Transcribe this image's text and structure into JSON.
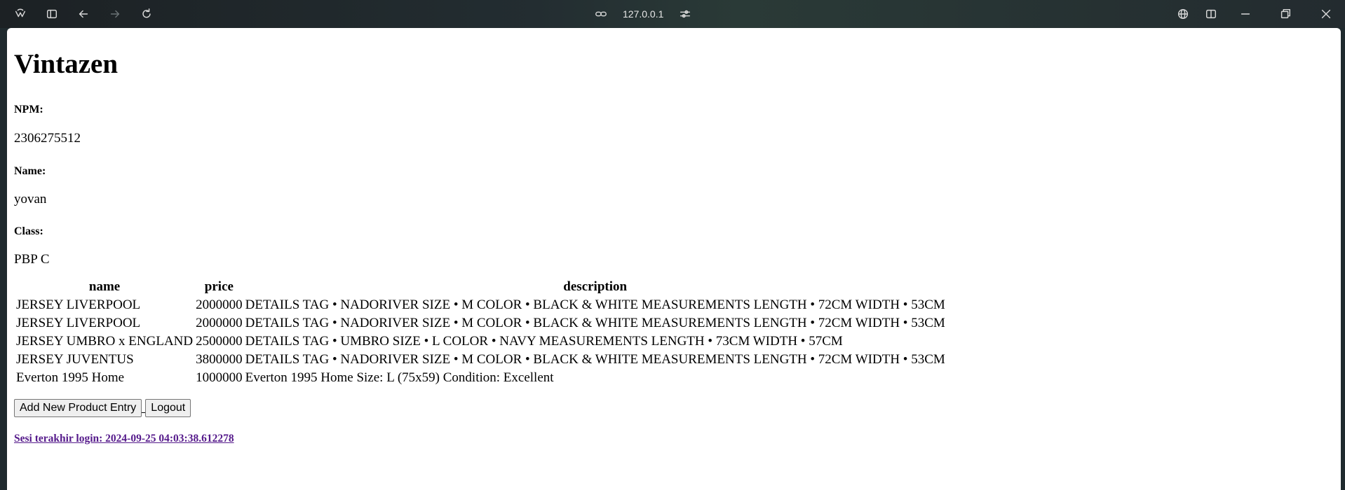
{
  "browser": {
    "url": "127.0.0.1",
    "icons": {
      "app": "browser-logo-icon",
      "sidebar": "sidebar-toggle-icon",
      "back": "back-arrow-icon",
      "forward": "forward-arrow-icon",
      "reload": "reload-icon",
      "link": "link-icon",
      "site_settings": "site-settings-icon",
      "translate": "globe-icon",
      "split": "split-view-icon",
      "minimize": "minimize-icon",
      "restore": "restore-icon",
      "close": "close-icon"
    }
  },
  "page": {
    "title": "Vintazen",
    "npm_label": "NPM:",
    "npm_value": "2306275512",
    "name_label": "Name:",
    "name_value": "yovan",
    "class_label": "Class:",
    "class_value": "PBP C"
  },
  "table": {
    "headers": [
      "name",
      "price",
      "description"
    ],
    "rows": [
      [
        "JERSEY LIVERPOOL",
        "2000000",
        "DETAILS TAG • NADORIVER SIZE • M COLOR • BLACK & WHITE MEASUREMENTS LENGTH • 72CM WIDTH • 53CM"
      ],
      [
        "JERSEY LIVERPOOL",
        "2000000",
        "DETAILS TAG • NADORIVER SIZE • M COLOR • BLACK & WHITE MEASUREMENTS LENGTH • 72CM WIDTH • 53CM"
      ],
      [
        "JERSEY UMBRO x ENGLAND",
        "2500000",
        "DETAILS TAG • UMBRO SIZE • L COLOR • NAVY MEASUREMENTS LENGTH • 73CM WIDTH • 57CM"
      ],
      [
        "JERSEY JUVENTUS",
        "3800000",
        "DETAILS TAG • NADORIVER SIZE • M COLOR • BLACK & WHITE MEASUREMENTS LENGTH • 72CM WIDTH • 53CM"
      ],
      [
        "Everton 1995 Home",
        "1000000",
        "Everton 1995 Home Size: L (75x59) Condition: Excellent"
      ]
    ]
  },
  "actions": {
    "add_label": "Add New Product Entry",
    "logout_label": "Logout"
  },
  "footer": {
    "last_login": "Sesi terakhir login: 2024-09-25 04:03:38.612278"
  }
}
